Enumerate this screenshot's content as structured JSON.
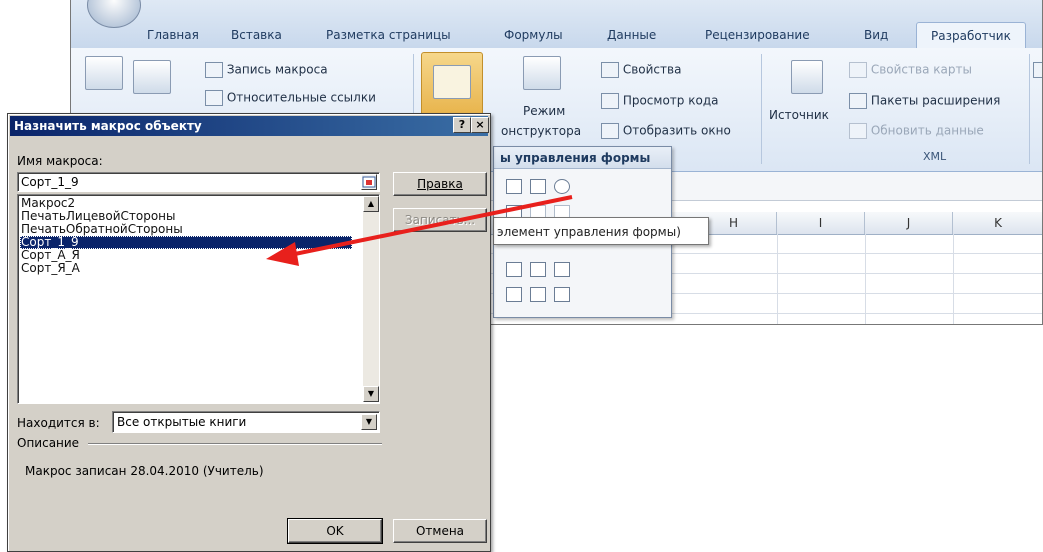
{
  "ribbon": {
    "tabs": [
      {
        "label": "Главная"
      },
      {
        "label": "Вставка"
      },
      {
        "label": "Разметка страницы"
      },
      {
        "label": "Формулы"
      },
      {
        "label": "Данные"
      },
      {
        "label": "Рецензирование"
      },
      {
        "label": "Вид"
      },
      {
        "label": "Разработчик",
        "active": true
      }
    ],
    "record_macro": "Запись макроса",
    "relative_refs": "Относительные ссылки",
    "design_mode_line1": "Режим",
    "design_mode_line2": "онструктора",
    "properties": "Свойства",
    "view_code": "Просмотр кода",
    "show_window": "Отобразить окно",
    "source": "Источник",
    "map_properties": "Свойства карты",
    "expansion_packs": "Пакеты расширения",
    "refresh_data": "Обновить данные",
    "xml_group": "XML"
  },
  "sheet": {
    "columns": [
      "H",
      "I",
      "J",
      "K"
    ]
  },
  "form_controls": {
    "title": "ы управления формы",
    "tooltip": "элемент управления формы)"
  },
  "dialog": {
    "title": "Назначить макрос объекту",
    "help_btn": "?",
    "close_btn": "×",
    "macro_name_label": "Имя макроса:",
    "macro_name_value": "Сорт_1_9",
    "edit_btn": "Правка",
    "record_btn": "Записать...",
    "macros": [
      "Макрос2",
      "ПечатьЛицевойСтороны",
      "ПечатьОбратнойСтороны",
      "Сорт_1_9",
      "Сорт_А_Я",
      "Сорт_Я_А"
    ],
    "selected_index": 3,
    "location_label": "Находится в:",
    "location_value": "Все открытые книги",
    "description_label": "Описание",
    "description_text": "Макрос записан 28.04.2010 (Учитель)",
    "ok_btn": "OK",
    "cancel_btn": "Отмена"
  },
  "colors": {
    "arrow": "#e8201c",
    "selection": "#0a246a",
    "title_bar": "#0a246a"
  }
}
